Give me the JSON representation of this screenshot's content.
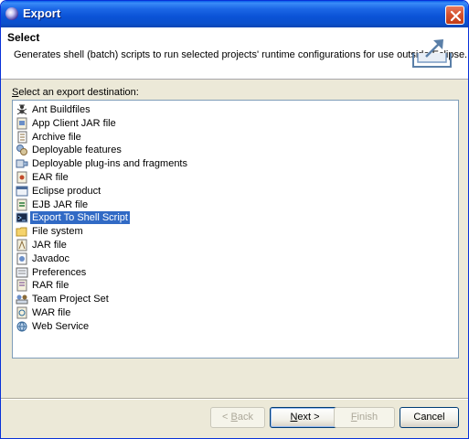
{
  "window": {
    "title": "Export"
  },
  "header": {
    "title": "Select",
    "description": "Generates shell (batch) scripts to run selected projects' runtime configurations for use outside Eclipse."
  },
  "destination_label": {
    "mnemonic": "S",
    "rest": "elect an export destination:"
  },
  "list": {
    "items": [
      {
        "label": "Ant Buildfiles",
        "icon": "ant-icon"
      },
      {
        "label": "App Client JAR file",
        "icon": "app-client-jar-icon"
      },
      {
        "label": "Archive file",
        "icon": "archive-file-icon"
      },
      {
        "label": "Deployable features",
        "icon": "deployable-features-icon"
      },
      {
        "label": "Deployable plug-ins and fragments",
        "icon": "deployable-plugins-icon"
      },
      {
        "label": "EAR file",
        "icon": "ear-file-icon"
      },
      {
        "label": "Eclipse product",
        "icon": "eclipse-product-icon"
      },
      {
        "label": "EJB JAR file",
        "icon": "ejb-jar-icon"
      },
      {
        "label": "Export To Shell Script",
        "icon": "shell-script-icon",
        "selected": true
      },
      {
        "label": "File system",
        "icon": "folder-icon"
      },
      {
        "label": "JAR file",
        "icon": "jar-file-icon"
      },
      {
        "label": "Javadoc",
        "icon": "javadoc-icon"
      },
      {
        "label": "Preferences",
        "icon": "preferences-icon"
      },
      {
        "label": "RAR file",
        "icon": "rar-file-icon"
      },
      {
        "label": "Team Project Set",
        "icon": "team-project-set-icon"
      },
      {
        "label": "WAR file",
        "icon": "war-file-icon"
      },
      {
        "label": "Web Service",
        "icon": "web-service-icon"
      }
    ]
  },
  "buttons": {
    "back": {
      "prefix": "< ",
      "mnemonic": "B",
      "rest": "ack"
    },
    "next": {
      "mnemonic": "N",
      "rest": "ext >"
    },
    "finish": {
      "mnemonic": "F",
      "rest": "inish"
    },
    "cancel": "Cancel"
  },
  "colors": {
    "selection": "#316ac5",
    "titlebar": "#0a52d6",
    "dialog_bg": "#ece9d8"
  }
}
